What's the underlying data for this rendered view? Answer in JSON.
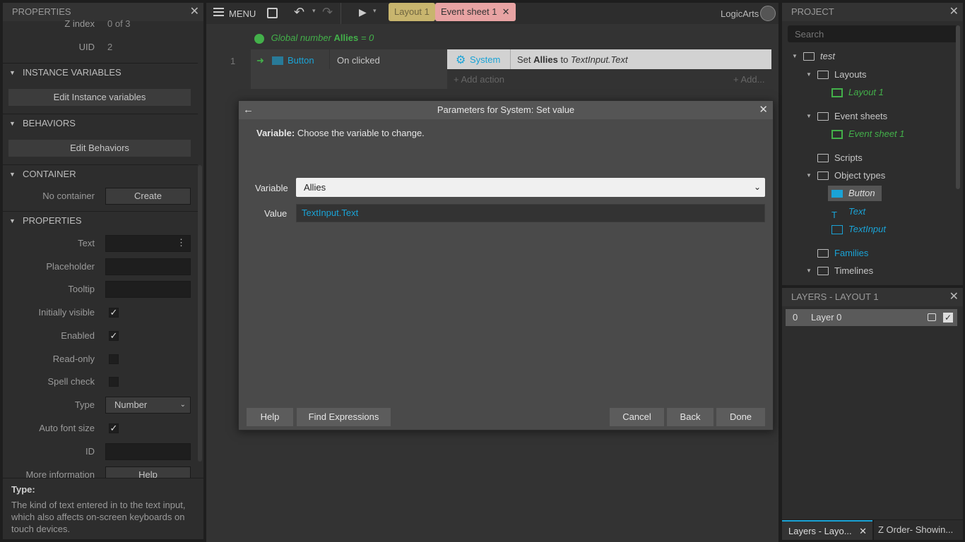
{
  "left_panel": {
    "title": "PROPERTIES",
    "z_index_label": "Z index",
    "z_index_value": "0 of 3",
    "uid_label": "UID",
    "uid_value": "2",
    "instance_variables_section": "INSTANCE VARIABLES",
    "edit_instance_variables": "Edit Instance variables",
    "behaviors_section": "BEHAVIORS",
    "edit_behaviors": "Edit Behaviors",
    "container_section": "CONTAINER",
    "no_container": "No container",
    "create": "Create",
    "properties_section": "PROPERTIES",
    "props": {
      "text": "Text",
      "placeholder": "Placeholder",
      "tooltip": "Tooltip",
      "initially_visible": "Initially visible",
      "enabled": "Enabled",
      "read_only": "Read-only",
      "spell_check": "Spell check",
      "type": "Type",
      "type_value": "Number",
      "auto_font_size": "Auto font size",
      "id": "ID",
      "more_information": "More information",
      "help": "Help"
    },
    "help_title": "Type:",
    "help_text": "The kind of text entered in to the text input, which also affects on-screen keyboards on touch devices."
  },
  "toolbar": {
    "menu": "MENU",
    "tab_layout": "Layout 1",
    "tab_event_sheet": "Event sheet 1",
    "brand": "LogicArts"
  },
  "event_sheet": {
    "global_prefix": "Global number",
    "global_name": "Allies",
    "global_value": "= 0",
    "event_number": "1",
    "condition_object": "Button",
    "condition_text": "On clicked",
    "action_object": "System",
    "action_set": "Set",
    "action_var": "Allies",
    "action_to": "to",
    "action_expr": "TextInput.Text",
    "add_action": "Add action",
    "add_short": "Add..."
  },
  "dialog": {
    "title": "Parameters for System: Set value",
    "desc_label": "Variable:",
    "desc_text": "Choose the variable to change.",
    "variable_label": "Variable",
    "variable_value": "Allies",
    "value_label": "Value",
    "value_object": "TextInput",
    "value_prop": ".Text",
    "help": "Help",
    "find_expressions": "Find Expressions",
    "cancel": "Cancel",
    "back": "Back",
    "done": "Done"
  },
  "project": {
    "title": "PROJECT",
    "search_placeholder": "Search",
    "root": "test",
    "layouts": "Layouts",
    "layout1": "Layout 1",
    "event_sheets": "Event sheets",
    "event_sheet1": "Event sheet 1",
    "scripts": "Scripts",
    "object_types": "Object types",
    "obj_button": "Button",
    "obj_text": "Text",
    "obj_textinput": "TextInput",
    "families": "Families",
    "timelines": "Timelines"
  },
  "layers": {
    "title": "LAYERS - LAYOUT 1",
    "layer_index": "0",
    "layer_name": "Layer 0"
  },
  "bottom_tabs": {
    "layers_tab": "Layers - Layo...",
    "zorder_tab": "Z Order- Showin..."
  },
  "colors": {
    "accent_blue": "#1aa3d6",
    "accent_green": "#43b04a",
    "tab_event_bg": "#e8a3a3",
    "tab_layout_bg": "#c8b56e"
  }
}
